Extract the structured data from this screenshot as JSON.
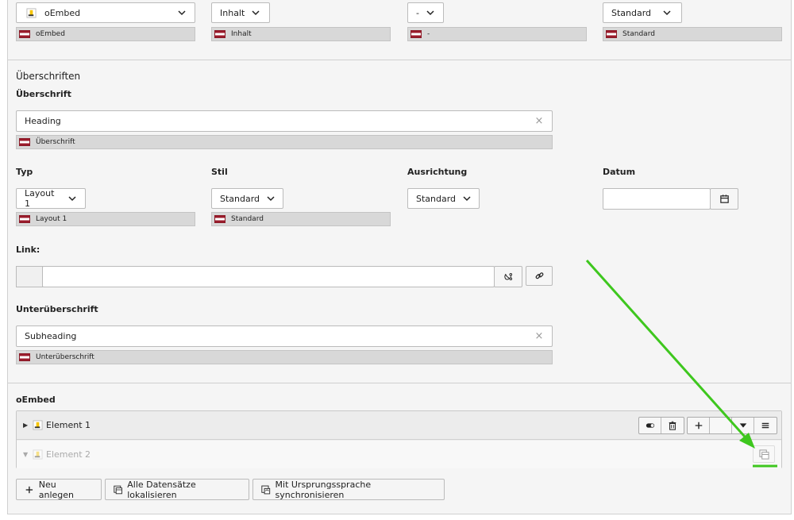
{
  "colors": {
    "panel_bg": "#f5f5f5",
    "flag_red": "#9b1b2b",
    "annotation_green": "#3ec71e",
    "ce_icon_yellow": "#f5c400"
  },
  "top_row": {
    "field1": {
      "icon": "oembed-content-icon",
      "value": "oEmbed",
      "lang_value": "oEmbed"
    },
    "field2": {
      "value": "Inhalt",
      "lang_value": "Inhalt"
    },
    "field3": {
      "value": "-",
      "lang_value": "-"
    },
    "field4": {
      "value": "Standard",
      "lang_value": "Standard"
    }
  },
  "headers": {
    "section_title": "Überschriften",
    "heading": {
      "label": "Überschrift",
      "value": "Heading",
      "lang_value": "Überschrift",
      "clear": "×"
    },
    "typ": {
      "label": "Typ",
      "value": "Layout 1",
      "lang_value": "Layout 1"
    },
    "stil": {
      "label": "Stil",
      "value": "Standard",
      "lang_value": "Standard"
    },
    "ausrichtung": {
      "label": "Ausrichtung",
      "value": "Standard"
    },
    "datum": {
      "label": "Datum",
      "value": ""
    },
    "link": {
      "label": "Link:",
      "value": ""
    },
    "subheading": {
      "label": "Unterüberschrift",
      "value": "Subheading",
      "lang_value": "Unterüberschrift",
      "clear": "×"
    }
  },
  "oembed": {
    "label": "oEmbed",
    "elements": [
      {
        "title": "Element 1",
        "caret": "▶"
      },
      {
        "title": "Element 2",
        "caret": "▼"
      }
    ]
  },
  "actions": {
    "new": "Neu anlegen",
    "localize_all": "Alle Datensätze lokalisieren",
    "sync": "Mit Ursprungssprache synchronisieren"
  }
}
